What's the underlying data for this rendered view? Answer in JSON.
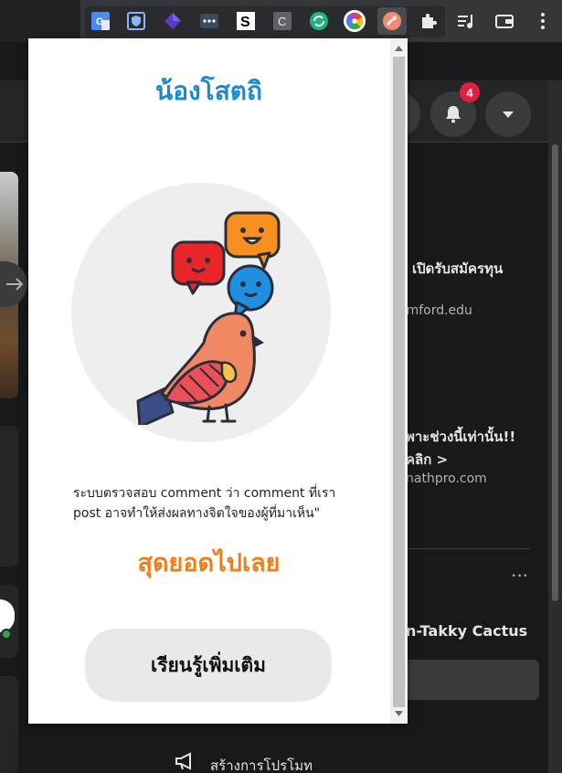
{
  "browser": {
    "extensions": [
      {
        "name": "google-translate-icon"
      },
      {
        "name": "shield-extension-icon"
      },
      {
        "name": "purple-gem-icon"
      },
      {
        "name": "dots-extension-icon"
      },
      {
        "name": "s-extension-icon",
        "label": "S"
      },
      {
        "name": "c-extension-icon",
        "label": "C"
      },
      {
        "name": "green-refresh-icon"
      },
      {
        "name": "color-wheel-icon"
      },
      {
        "name": "active-extension-icon"
      },
      {
        "name": "puzzle-icon"
      }
    ],
    "right_icons": [
      "reading-list-icon",
      "wallet-icon",
      "menu-icon"
    ]
  },
  "facebook": {
    "notification_count": "4",
    "ads": [
      {
        "title": "ด เปิดรับสมัครทุน",
        "domain": "amford.edu"
      },
      {
        "title_line1": "พาะช่วงนี้เท่านั้น!!",
        "title_line2": "คลิก >",
        "domain": "nathpro.com"
      }
    ],
    "page_name": "n-Takky Cactus",
    "promote_label": "สร้างการโปรโมท"
  },
  "popup": {
    "title": "น้องโสตถิ",
    "description": "ระบบตรวจสอบ comment ว่า comment ที่เรา post อาจทำให้ส่งผลทางจิตใจของผู้ที่มาเห็น\"",
    "highlight": "สุดยอดไปเลย",
    "learn_more_label": "เรียนรู้เพิ่มเติม"
  },
  "colors": {
    "title_blue": "#1b8bd0",
    "highlight_orange": "#f07d17",
    "badge_red": "#e41e3f"
  }
}
